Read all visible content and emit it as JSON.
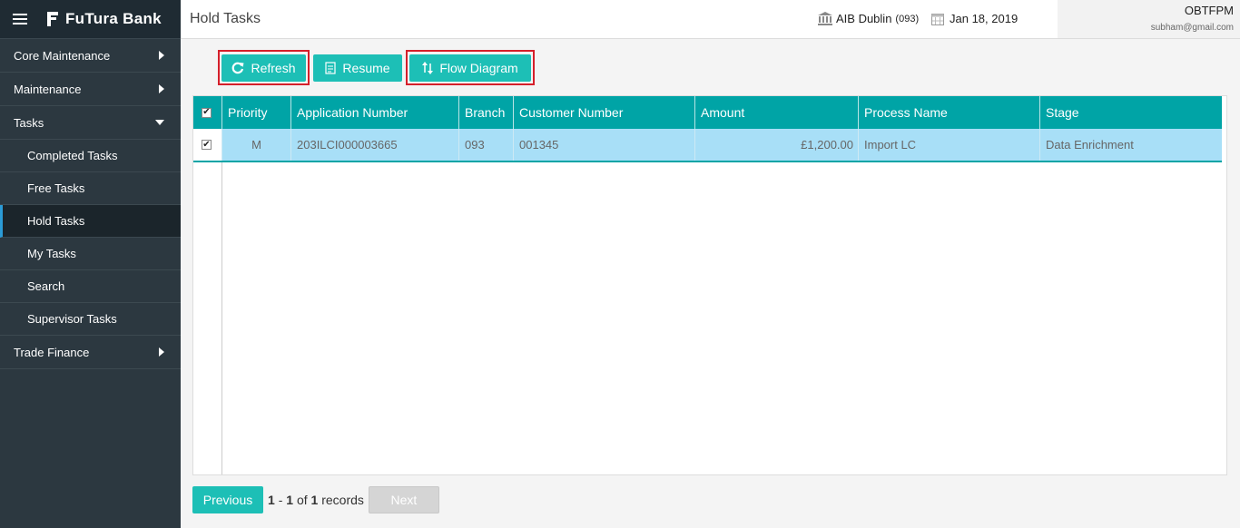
{
  "brand": {
    "name": "FuTura Bank"
  },
  "sidebar": {
    "items": [
      {
        "label": "Core Maintenance"
      },
      {
        "label": "Maintenance"
      },
      {
        "label": "Tasks"
      },
      {
        "label": "Trade Finance"
      }
    ],
    "task_items": [
      {
        "label": "Completed Tasks"
      },
      {
        "label": "Free Tasks"
      },
      {
        "label": "Hold Tasks"
      },
      {
        "label": "My Tasks"
      },
      {
        "label": "Search"
      },
      {
        "label": "Supervisor Tasks"
      }
    ]
  },
  "header": {
    "title": "Hold Tasks",
    "branch_name": "AIB Dublin",
    "branch_code": "(093)",
    "date": "Jan 18, 2019",
    "user_name": "OBTFPM",
    "user_email": "subham@gmail.com"
  },
  "toolbar": {
    "refresh_label": "Refresh",
    "resume_label": "Resume",
    "flow_label": "Flow Diagram"
  },
  "table": {
    "columns": [
      "Priority",
      "Application Number",
      "Branch",
      "Customer Number",
      "Amount",
      "Process Name",
      "Stage"
    ],
    "rows": [
      {
        "priority": "M",
        "application_number": "203ILCI000003665",
        "branch": "093",
        "customer_number": "001345",
        "amount": "£1,200.00",
        "process_name": "Import LC",
        "stage": "Data Enrichment"
      }
    ]
  },
  "pagination": {
    "prev_label": "Previous",
    "range_start": "1",
    "dash": "-",
    "range_end": "1",
    "of": "of",
    "total": "1",
    "records": "records",
    "next_label": "Next"
  },
  "colors": {
    "accent": "#1dbfb6",
    "header_teal": "#00a4a6",
    "highlight_red": "#d51f2a",
    "selected_row": "#a8dff7",
    "sidebar": "#2c3840"
  },
  "icons": [
    "hamburger-icon",
    "bank-logo-icon",
    "bank-building-icon",
    "calendar-icon",
    "refresh-icon",
    "resume-icon",
    "flow-diagram-icon",
    "chevron-right-icon",
    "chevron-down-icon"
  ]
}
